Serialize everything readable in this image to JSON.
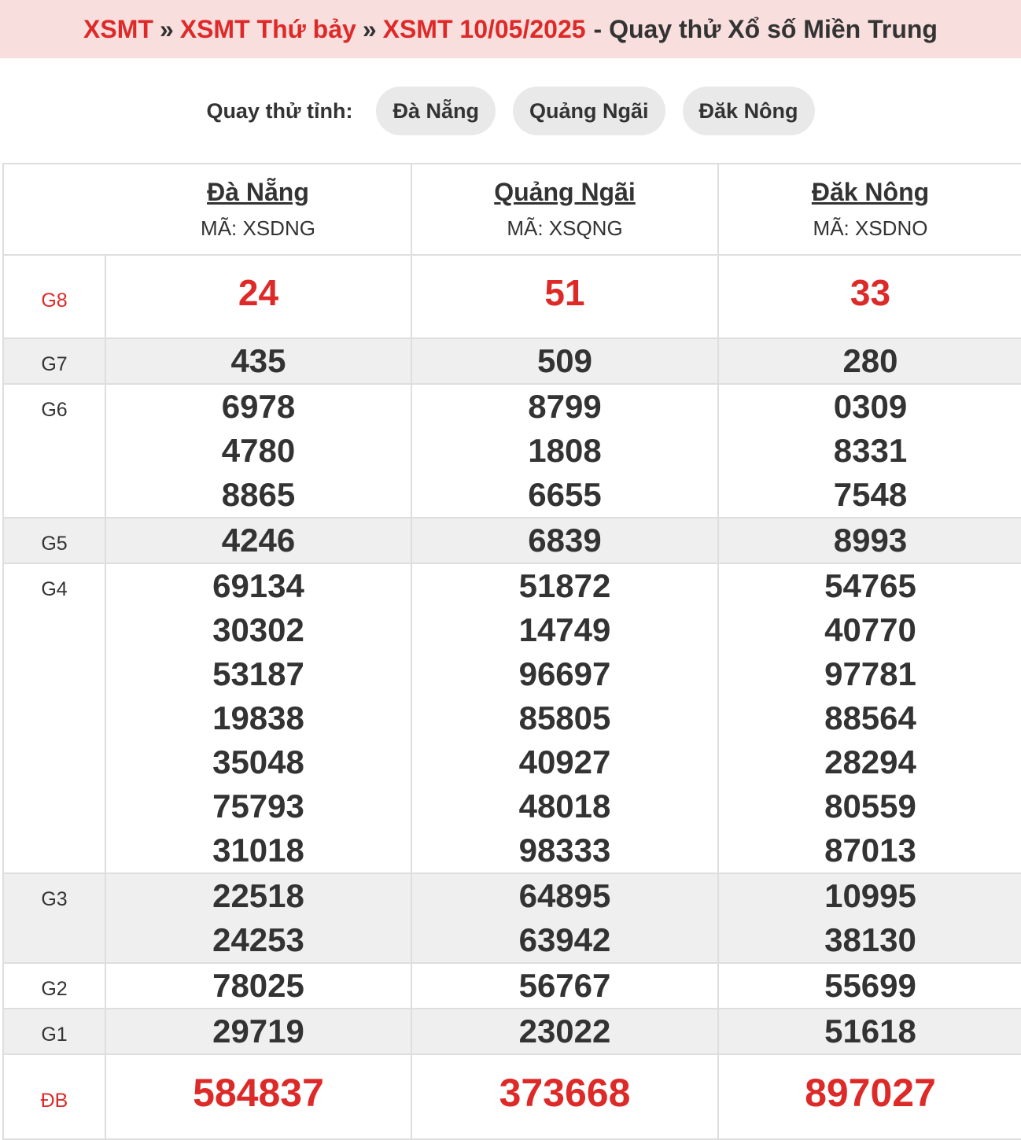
{
  "header": {
    "crumb1": "XSMT",
    "crumb2": "XSMT Thứ bảy",
    "crumb3": "XSMT 10/05/2025",
    "sep": "»",
    "tail": "- Quay thử Xổ số Miền Trung"
  },
  "try_bar": {
    "label": "Quay thử tỉnh:",
    "provinces": [
      "Đà Nẵng",
      "Quảng Ngãi",
      "Đăk Nông"
    ]
  },
  "table": {
    "columns": [
      {
        "name": "Đà Nẵng",
        "code": "MÃ: XSDNG"
      },
      {
        "name": "Quảng Ngãi",
        "code": "MÃ: XSQNG"
      },
      {
        "name": "Đăk Nông",
        "code": "MÃ: XSDNO"
      }
    ],
    "prizes": [
      {
        "label": "G8",
        "style": "g8",
        "values": [
          [
            "24"
          ],
          [
            "51"
          ],
          [
            "33"
          ]
        ]
      },
      {
        "label": "G7",
        "style": "gray",
        "values": [
          [
            "435"
          ],
          [
            "509"
          ],
          [
            "280"
          ]
        ]
      },
      {
        "label": "G6",
        "style": "",
        "values": [
          [
            "6978",
            "4780",
            "8865"
          ],
          [
            "8799",
            "1808",
            "6655"
          ],
          [
            "0309",
            "8331",
            "7548"
          ]
        ]
      },
      {
        "label": "G5",
        "style": "gray",
        "values": [
          [
            "4246"
          ],
          [
            "6839"
          ],
          [
            "8993"
          ]
        ]
      },
      {
        "label": "G4",
        "style": "",
        "values": [
          [
            "69134",
            "30302",
            "53187",
            "19838",
            "35048",
            "75793",
            "31018"
          ],
          [
            "51872",
            "14749",
            "96697",
            "85805",
            "40927",
            "48018",
            "98333"
          ],
          [
            "54765",
            "40770",
            "97781",
            "88564",
            "28294",
            "80559",
            "87013"
          ]
        ]
      },
      {
        "label": "G3",
        "style": "gray",
        "values": [
          [
            "22518",
            "24253"
          ],
          [
            "64895",
            "63942"
          ],
          [
            "10995",
            "38130"
          ]
        ]
      },
      {
        "label": "G2",
        "style": "",
        "values": [
          [
            "78025"
          ],
          [
            "56767"
          ],
          [
            "55699"
          ]
        ]
      },
      {
        "label": "G1",
        "style": "gray",
        "values": [
          [
            "29719"
          ],
          [
            "23022"
          ],
          [
            "51618"
          ]
        ]
      },
      {
        "label": "ĐB",
        "style": "db",
        "values": [
          [
            "584837"
          ],
          [
            "373668"
          ],
          [
            "897027"
          ]
        ]
      }
    ]
  },
  "colors": {
    "accent_red": "#dd2a28",
    "header_bg": "#f9dede",
    "pill_bg": "#e9e9e9",
    "row_gray": "#efefef"
  }
}
